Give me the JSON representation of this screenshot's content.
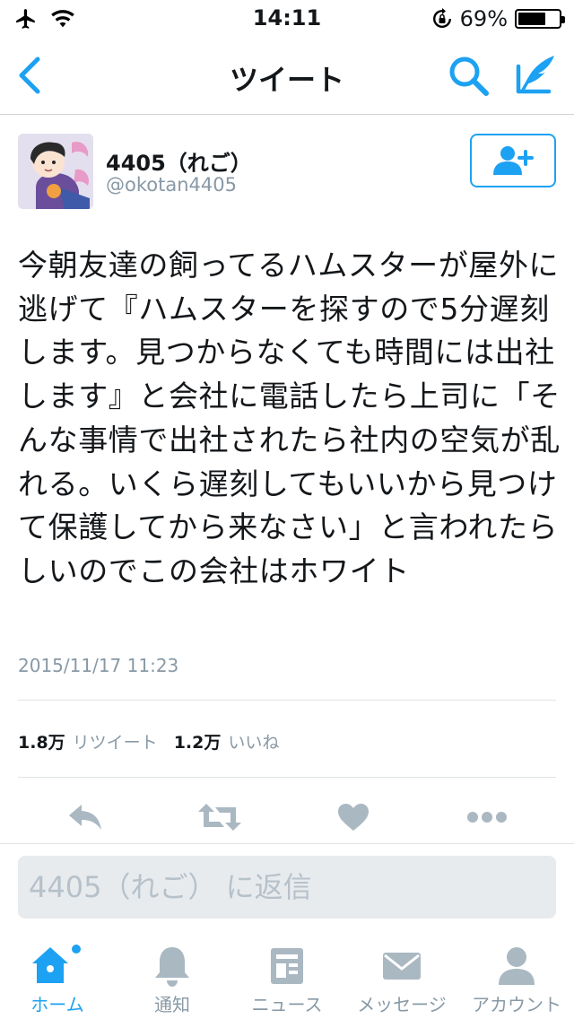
{
  "status_bar": {
    "time": "14:11",
    "battery_percent": "69%",
    "battery_level": 0.69
  },
  "nav": {
    "title": "ツイート",
    "back_icon": "chevron-left-icon",
    "search_icon": "search-icon",
    "compose_icon": "compose-icon"
  },
  "tweet": {
    "user_name": "4405（れご）",
    "user_handle": "@okotan4405",
    "text": "今朝友達の飼ってるハムスターが屋外に逃げて『ハムスターを探すので5分遅刻します。見つからなくても時間には出社します』と会社に電話したら上司に「そんな事情で出社されたら社内の空気が乱れる。いくら遅刻してもいいから見つけて保護してから来なさい」と言われたらしいのでこの会社はホワイト",
    "timestamp": "2015/11/17 11:23",
    "retweets_count": "1.8万",
    "retweets_label": "リツイート",
    "likes_count": "1.2万",
    "likes_label": "いいね"
  },
  "reply": {
    "placeholder": "4405（れご） に返信"
  },
  "tabs": [
    {
      "label": "ホーム",
      "icon": "home-icon",
      "active": true
    },
    {
      "label": "通知",
      "icon": "bell-icon",
      "active": false
    },
    {
      "label": "ニュース",
      "icon": "news-icon",
      "active": false
    },
    {
      "label": "メッセージ",
      "icon": "envelope-icon",
      "active": false
    },
    {
      "label": "アカウント",
      "icon": "person-icon",
      "active": false
    }
  ],
  "colors": {
    "accent": "#1da1f2",
    "muted": "#8899a6",
    "action_gray": "#aab8c2"
  }
}
